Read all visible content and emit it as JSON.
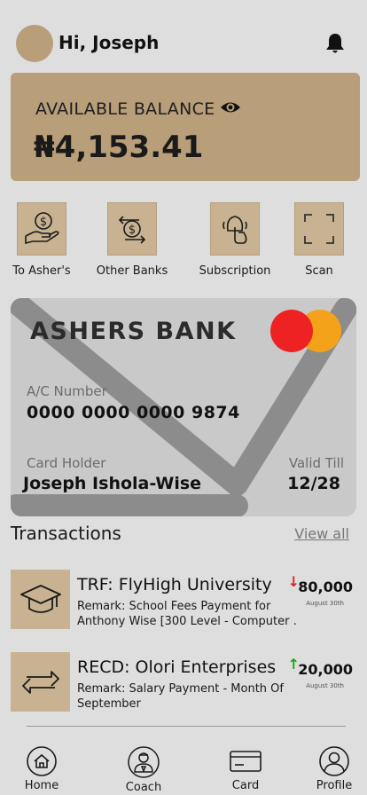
{
  "header": {
    "greeting": "Hi, Joseph"
  },
  "balance": {
    "label": "AVAILABLE BALANCE",
    "amount": "₦4,153.41"
  },
  "quick_actions": [
    {
      "label": "To Asher's",
      "icon": "hand-coin-icon"
    },
    {
      "label": "Other Banks",
      "icon": "transfer-coin-icon"
    },
    {
      "label": "Subscription",
      "icon": "touch-bell-icon"
    },
    {
      "label": "Scan",
      "icon": "scan-frame-icon"
    }
  ],
  "card": {
    "bank_name": "ASHERS BANK",
    "account_label": "A/C Number",
    "account_number": "0000 0000 0000 9874",
    "holder_label": "Card Holder",
    "holder_name": "Joseph Ishola-Wise",
    "valid_label": "Valid Till",
    "valid_till": "12/28"
  },
  "transactions": {
    "title": "Transactions",
    "view_all": "View all",
    "items": [
      {
        "name": "TRF: FlyHigh University",
        "remark": "Remark: School Fees Payment for Anthony Wise [300 Level - Computer . . .",
        "amount": "80,000",
        "direction": "↓",
        "direction_color": "#e02020",
        "date": "August 30th",
        "icon": "graduation-cap-icon"
      },
      {
        "name": "RECD: Olori Enterprises",
        "remark": "Remark: Salary Payment - Month Of September",
        "amount": "20,000",
        "direction": "↑",
        "direction_color": "#1aa51a",
        "date": "August 30th",
        "icon": "swap-arrows-icon"
      }
    ]
  },
  "nav": [
    {
      "label": "Home",
      "icon": "home-icon"
    },
    {
      "label": "Coach",
      "icon": "coach-icon"
    },
    {
      "label": "Card",
      "icon": "card-icon"
    },
    {
      "label": "Profile",
      "icon": "profile-icon"
    }
  ],
  "colors": {
    "accent": "#b89e79",
    "background": "#dedede",
    "card": "#c9c9c9"
  }
}
